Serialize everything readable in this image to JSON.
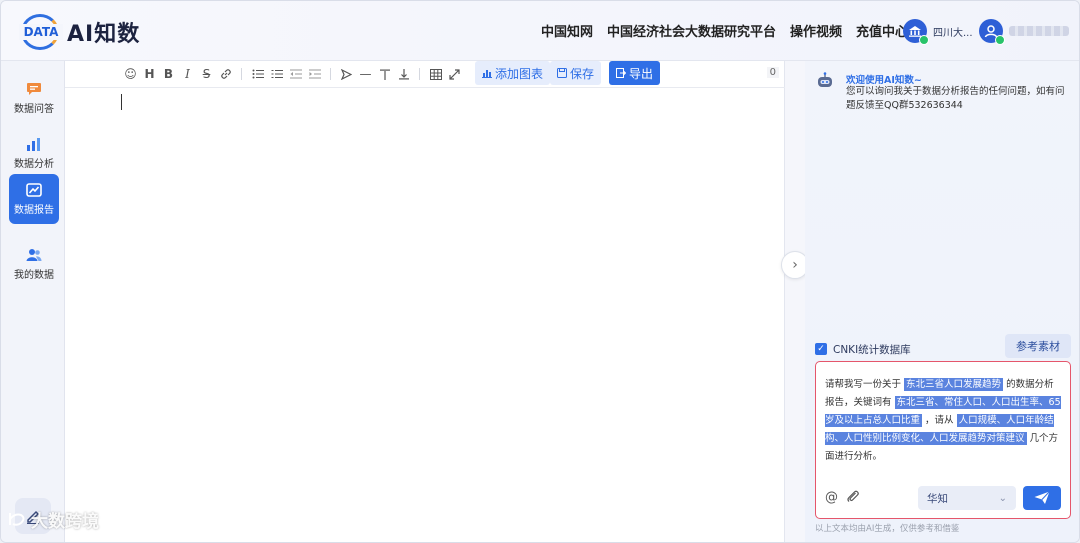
{
  "header": {
    "logo_badge": "DATA",
    "app_title": "AI知数",
    "nav": [
      "中国知网",
      "中国经济社会大数据研究平台",
      "操作视频",
      "充值中心"
    ],
    "org_name": "四川大..."
  },
  "sidebar": {
    "items": [
      {
        "label": "数据问答",
        "icon": "chat-bubble-icon",
        "active": false
      },
      {
        "label": "数据分析",
        "icon": "bar-chart-icon",
        "active": false
      },
      {
        "label": "数据报告",
        "icon": "report-icon",
        "active": true
      },
      {
        "label": "我的数据",
        "icon": "users-icon",
        "active": false
      }
    ]
  },
  "toolbar": {
    "add_chart_label": "添加图表",
    "save_label": "保存",
    "export_label": "导出",
    "word_count": "0"
  },
  "chat": {
    "welcome_title": "欢迎使用AI知数~",
    "welcome_message": "您可以询问我关于数据分析报告的任何问题，如有问题反馈至QQ群532636344",
    "source_label": "CNKI统计数据库",
    "source_checked": true,
    "reference_button": "参考素材",
    "prompt": {
      "p1": "请帮我写一份关于",
      "topic": "东北三省人口发展趋势",
      "p2": "的数据分析报告，关键词有",
      "keywords": "东北三省、常住人口、人口出生率、65岁及以上占总人口比重",
      "p3": "，请从",
      "aspects": "人口规模、人口年龄结构、人口性别比例变化、人口发展趋势对策建议",
      "p4": "几个方面进行分析。"
    },
    "model": "华知",
    "footnote": "以上文本均由AI生成，仅供参考和借鉴"
  },
  "watermark": "大数跨境",
  "colors": {
    "accent": "#2f6fe6",
    "input_border": "#e5566b",
    "highlight": "#5a83df"
  }
}
